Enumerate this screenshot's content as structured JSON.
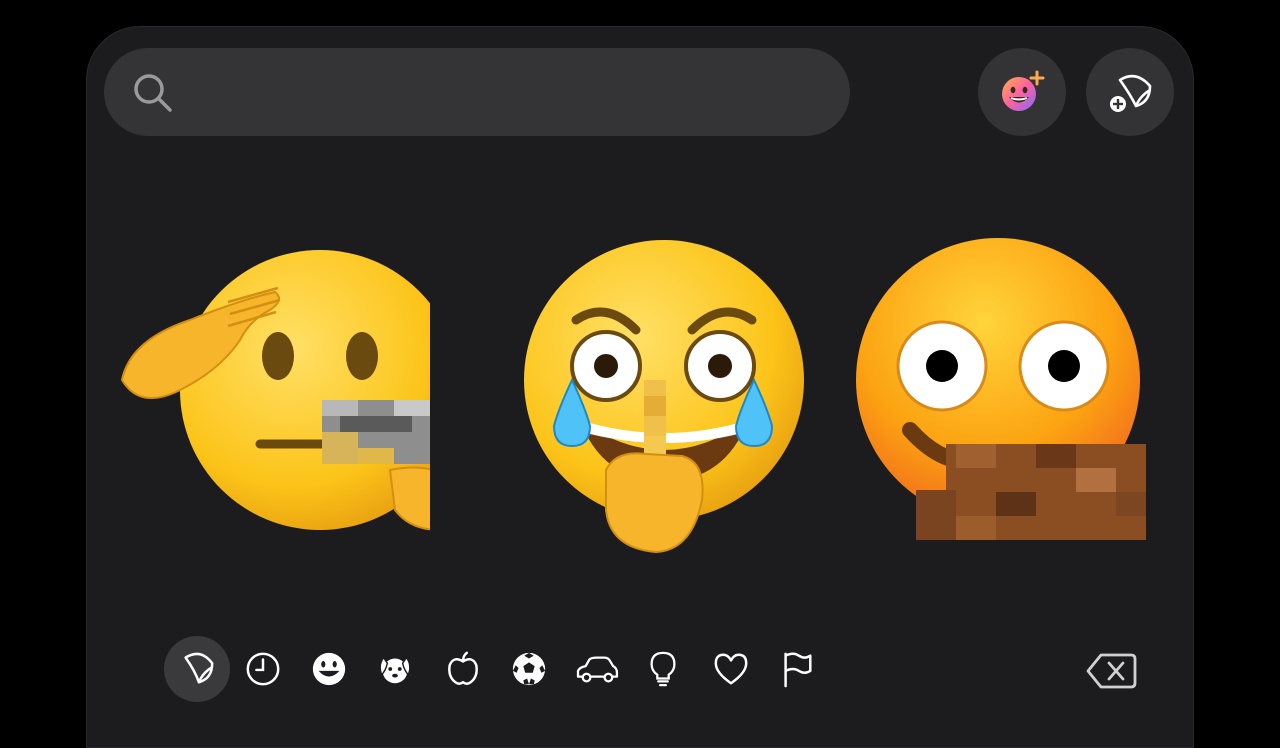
{
  "search": {
    "value": "",
    "placeholder": ""
  },
  "header_buttons": [
    {
      "name": "create-genmoji-button",
      "icon": "genmoji-plus-icon"
    },
    {
      "name": "add-sticker-button",
      "icon": "sticker-plus-icon"
    }
  ],
  "stickers": [
    {
      "name": "saluting-face-sticker",
      "pixelated": true
    },
    {
      "name": "crying-laughing-face-sticker",
      "pixelated": true
    },
    {
      "name": "wide-eyed-face-sticker",
      "pixelated": true
    }
  ],
  "categories": [
    {
      "name": "stickers",
      "icon": "sticker-icon",
      "active": true
    },
    {
      "name": "recents",
      "icon": "clock-icon",
      "active": false
    },
    {
      "name": "smileys",
      "icon": "smiley-icon",
      "active": false
    },
    {
      "name": "animals",
      "icon": "dog-icon",
      "active": false
    },
    {
      "name": "food",
      "icon": "apple-icon",
      "active": false
    },
    {
      "name": "activity",
      "icon": "soccer-ball-icon",
      "active": false
    },
    {
      "name": "travel",
      "icon": "car-icon",
      "active": false
    },
    {
      "name": "objects",
      "icon": "lightbulb-icon",
      "active": false
    },
    {
      "name": "symbols",
      "icon": "heart-icon",
      "active": false
    },
    {
      "name": "flags",
      "icon": "flag-icon",
      "active": false
    }
  ],
  "colors": {
    "background": "#000000",
    "panel": "#1c1c1e",
    "search_field": "#343437",
    "button": "#333336",
    "emoji_yellow": "#fcc419",
    "emoji_orange": "#f58b1f",
    "tear_blue": "#4fc3f7"
  }
}
